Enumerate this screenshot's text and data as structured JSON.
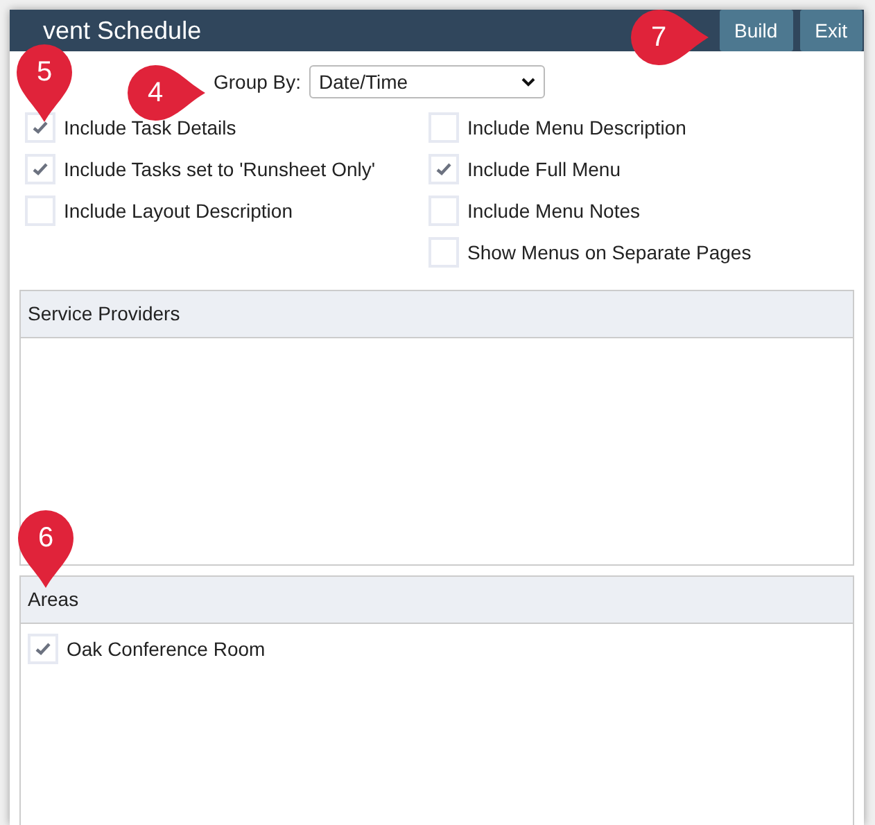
{
  "window": {
    "title": "vent Schedule"
  },
  "buttons": [
    "Build",
    "Exit"
  ],
  "group_by": {
    "label": "Group By:",
    "value": "Date/Time"
  },
  "options_left": [
    {
      "label": "Include Task Details",
      "checked": true
    },
    {
      "label": "Include Tasks set to 'Runsheet Only'",
      "checked": true
    },
    {
      "label": "Include Layout Description",
      "checked": false
    }
  ],
  "options_right": [
    {
      "label": "Include Menu Description",
      "checked": false
    },
    {
      "label": "Include Full Menu",
      "checked": true
    },
    {
      "label": "Include Menu Notes",
      "checked": false
    },
    {
      "label": "Show Menus on Separate Pages",
      "checked": false
    }
  ],
  "panels": [
    {
      "title": "Service Providers"
    },
    {
      "title": "Areas",
      "items": [
        {
          "label": "Oak Conference Room",
          "checked": true
        }
      ]
    }
  ],
  "callouts": [
    {
      "number": "5",
      "kind": "down"
    },
    {
      "number": "4",
      "kind": "right"
    },
    {
      "number": "6",
      "kind": "down"
    },
    {
      "number": "7",
      "kind": "right"
    }
  ]
}
